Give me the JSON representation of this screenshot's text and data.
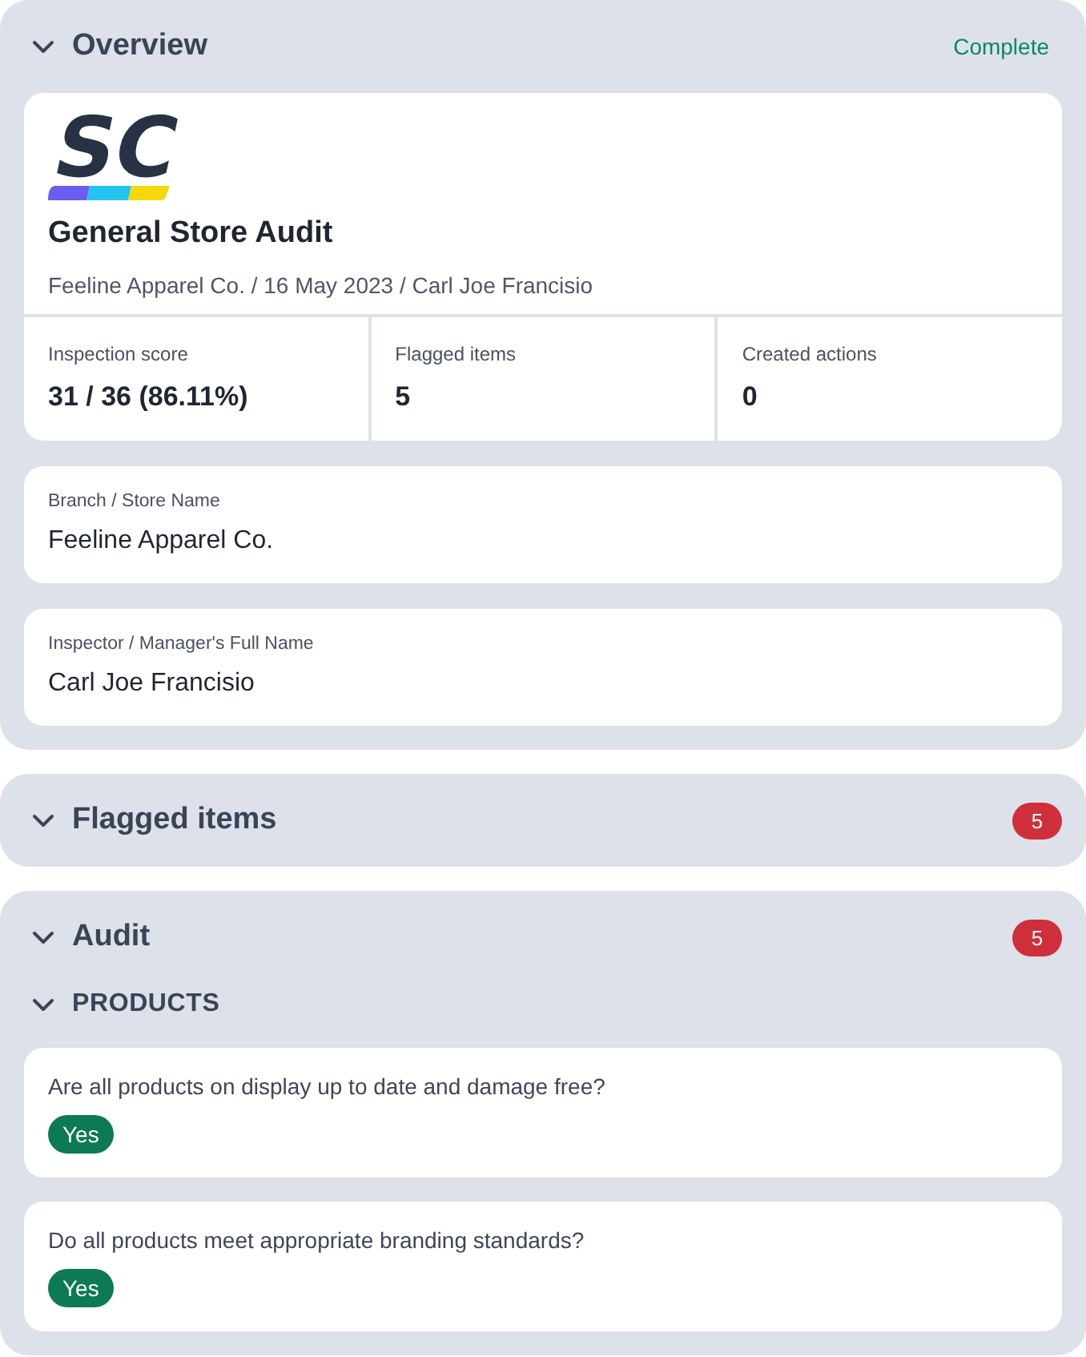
{
  "sections": [
    {
      "kind": "overview",
      "title": "Overview",
      "status": "Complete",
      "report": {
        "logo": "SC",
        "title": "General Store Audit",
        "meta": "Feeline Apparel Co. / 16 May 2023 / Carl Joe Francisio",
        "stats": [
          {
            "label": "Inspection score",
            "value": "31 / 36 (86.11%)"
          },
          {
            "label": "Flagged items",
            "value": "5"
          },
          {
            "label": "Created actions",
            "value": "0"
          }
        ]
      },
      "fields": [
        {
          "label": "Branch / Store Name",
          "value": "Feeline Apparel Co."
        },
        {
          "label": "Inspector / Manager's Full Name",
          "value": "Carl Joe Francisio"
        }
      ]
    },
    {
      "kind": "summary",
      "title": "Flagged items",
      "badge": "5"
    },
    {
      "kind": "audit",
      "title": "Audit",
      "badge": "5",
      "groups": [
        {
          "title": "PRODUCTS",
          "questions": [
            {
              "text": "Are all products on display up to date and damage free?",
              "answer": "Yes"
            },
            {
              "text": "Do all products meet appropriate branding standards?",
              "answer": "Yes"
            }
          ]
        }
      ]
    }
  ]
}
